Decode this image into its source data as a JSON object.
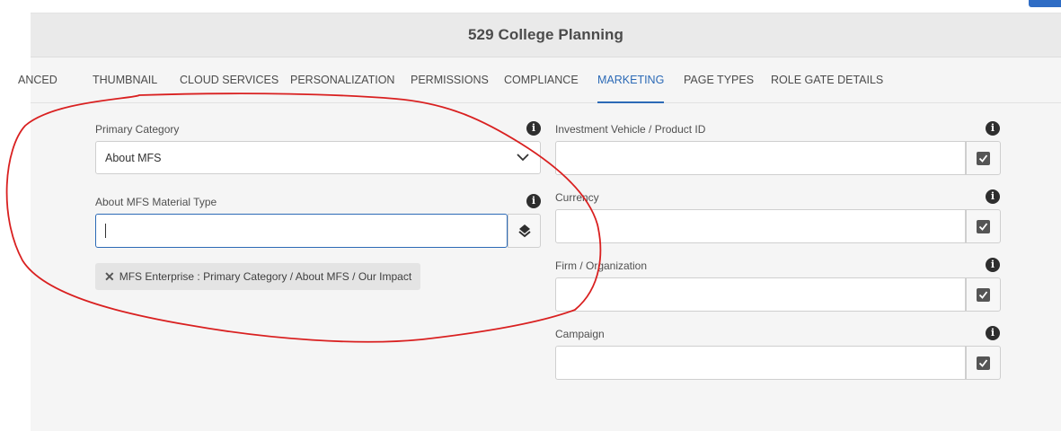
{
  "page": {
    "title": "529 College Planning"
  },
  "tabs": [
    {
      "label": "ANCED"
    },
    {
      "label": "THUMBNAIL"
    },
    {
      "label": "CLOUD SERVICES"
    },
    {
      "label": "PERSONALIZATION"
    },
    {
      "label": "PERMISSIONS"
    },
    {
      "label": "COMPLIANCE"
    },
    {
      "label": "MARKETING",
      "active": true
    },
    {
      "label": "PAGE TYPES"
    },
    {
      "label": "ROLE GATE DETAILS"
    }
  ],
  "left_fields": {
    "primary_category": {
      "label": "Primary Category",
      "value": "About MFS"
    },
    "material_type": {
      "label": "About MFS Material Type",
      "value": ""
    },
    "selected_tag": {
      "remove_glyph": "✕",
      "text": "MFS Enterprise : Primary Category / About MFS / Our Impact"
    }
  },
  "right_fields": [
    {
      "label": "Investment Vehicle / Product ID",
      "value": ""
    },
    {
      "label": "Currency",
      "value": ""
    },
    {
      "label": "Firm / Organization",
      "value": ""
    },
    {
      "label": "Campaign",
      "value": ""
    }
  ],
  "icons": {
    "info": "info-icon",
    "chevron": "chevron-down-icon",
    "tag": "tag-icon",
    "checkbox": "checkbox-checked-icon"
  },
  "colors": {
    "accent": "#2c6ab6",
    "annotation": "#d92020",
    "background": "#f5f5f5"
  }
}
